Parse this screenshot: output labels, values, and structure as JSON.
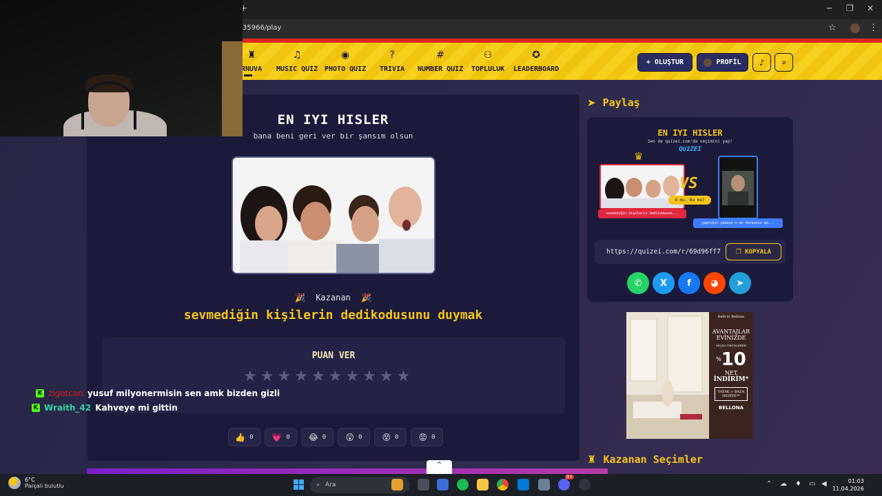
{
  "browser": {
    "new_tab": "+",
    "url": "35966/play",
    "minimize": "─",
    "maximize": "❐",
    "close": "✕",
    "bookmark": "☆",
    "menu": "⋮"
  },
  "nav": {
    "items": [
      {
        "label": "RNUVA",
        "icon": "trophy-icon",
        "glyph": "♜"
      },
      {
        "label": "MUSIC QUIZ",
        "icon": "music-note-icon",
        "glyph": "♫"
      },
      {
        "label": "PHOTO QUIZ",
        "icon": "camera-icon",
        "glyph": "◉"
      },
      {
        "label": "TRIVIA",
        "icon": "question-circle-icon",
        "glyph": "?"
      },
      {
        "label": "NUMBER QUIZ",
        "icon": "hash-icon",
        "glyph": "#"
      },
      {
        "label": "TOPLULUK",
        "icon": "users-icon",
        "glyph": "⚇"
      },
      {
        "label": "LEADERBOARD",
        "icon": "medal-icon",
        "glyph": "✪"
      }
    ],
    "create_label": "OLUŞTUR",
    "create_glyph": "+",
    "profile_label": "PROFİL",
    "bell_glyph": "♪",
    "search_glyph": "⌕"
  },
  "quiz": {
    "title": "EN IYI HISLER",
    "subtitle": "bana beni geri ver bir şansım olsun",
    "winner_label": "Kazanan",
    "winner_emoji": "🎉",
    "winner_text": "sevmediğin kişilerin dedikodusunu duymak",
    "rate_title": "PUAN VER",
    "star_glyph": "★",
    "star_count": 10,
    "rating_value": 0,
    "reactions": [
      {
        "icon": "thumbs-up-icon",
        "emoji": "👍",
        "count": "0"
      },
      {
        "icon": "heart-icon",
        "emoji": "💗",
        "count": "0"
      },
      {
        "icon": "laugh-icon",
        "emoji": "😂",
        "count": "0"
      },
      {
        "icon": "surprised-icon",
        "emoji": "😲",
        "count": "0"
      },
      {
        "icon": "dizzy-icon",
        "emoji": "😵",
        "count": "0"
      },
      {
        "icon": "angry-icon",
        "emoji": "😡",
        "count": "0"
      }
    ],
    "scroll_top_glyph": "⌃"
  },
  "share": {
    "heading": "Paylaş",
    "heading_glyph": "➤",
    "preview_title": "EN IYI HISLER",
    "preview_sub": "Sen de quizei.com'da seçimini yap!",
    "preview_logo": "QUIZEI",
    "preview_crown": "♛",
    "preview_left_caption": "sevmediğin kişilerin dedikodusun...",
    "preview_vs": "VS",
    "preview_pill": "O mu, Bu mu?",
    "preview_right_caption": "yaptığın şakaya o an herkesin gü...",
    "url": "https://quizei.com/r/69d96ff7",
    "copy_label": "KOPYALA",
    "copy_glyph": "❐",
    "socials": [
      {
        "name": "whatsapp-icon",
        "glyph": "✆",
        "color": "#25d366"
      },
      {
        "name": "x-icon",
        "glyph": "X",
        "color": "#1d9bf0"
      },
      {
        "name": "facebook-icon",
        "glyph": "f",
        "color": "#1877f2"
      },
      {
        "name": "reddit-icon",
        "glyph": "◕",
        "color": "#ff4500"
      },
      {
        "name": "telegram-icon",
        "glyph": "➤",
        "color": "#229ed9"
      }
    ]
  },
  "ad": {
    "brand_top": "Belli ki Bellona",
    "line1": "AVANTAJLAR",
    "line2": "EVİNİZDE",
    "line3": "SEÇİLİ ÜRÜNLERDE",
    "discount": "10",
    "discount_prefix": "%",
    "net": "NET",
    "indirim": "İNDİRİM*",
    "gift": "YATAK + BAZA HEDİYE**",
    "brand_bottom": "BELLONA"
  },
  "winners": {
    "heading": "Kazanan Seçimler",
    "heading_glyph": "♜"
  },
  "chat": [
    {
      "user": "zigotcan",
      "message": "yusuf milyonermisin sen amk bizden gizli"
    },
    {
      "user": "Wraith_42",
      "message": "Kahveye mi gittin"
    }
  ],
  "chat_badge": "K",
  "taskbar": {
    "temp": "6°C",
    "weather": "Parçalı bulutlu",
    "search": "Ara",
    "time": "01:03",
    "date": "11.04.2026",
    "discord_badge": "9+"
  },
  "colors": {
    "accent": "#f5c518",
    "nav_bg": "#f7cf1d",
    "card_bg": "#1b1a3a",
    "page_bg": "#2a2742"
  }
}
